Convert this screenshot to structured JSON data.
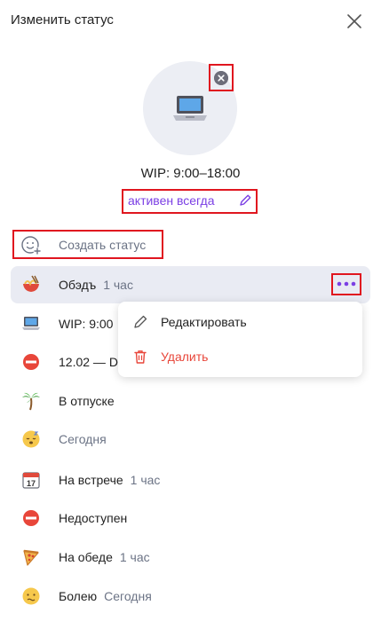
{
  "header": {
    "title": "Изменить статус"
  },
  "current_status": {
    "name": "WIP: 9:00–18:00",
    "active_label": "активен всегда",
    "emoji": "laptop-icon"
  },
  "create_status": {
    "label": "Создать статус"
  },
  "statuses": [
    {
      "name": "Обэдъ",
      "duration": "1 час",
      "emoji": "noodles-icon"
    },
    {
      "name": "WIP: 9:00",
      "duration": "",
      "emoji": "laptop-icon"
    },
    {
      "name": "12.02 — D",
      "duration": "",
      "emoji": "no-entry-icon"
    },
    {
      "name": "В отпуске",
      "duration": "",
      "emoji": "palm-tree-icon"
    },
    {
      "name": "",
      "duration": "Сегодня",
      "emoji": "sleeping-face-icon"
    },
    {
      "name": "На встрече",
      "duration": "1 час",
      "emoji": "calendar-icon"
    },
    {
      "name": "Недоступен",
      "duration": "",
      "emoji": "no-entry-icon"
    },
    {
      "name": "На обеде",
      "duration": "1 час",
      "emoji": "pizza-icon"
    },
    {
      "name": "Болею",
      "duration": "Сегодня",
      "emoji": "sick-face-icon"
    }
  ],
  "context_menu": {
    "edit_label": "Редактировать",
    "delete_label": "Удалить"
  },
  "colors": {
    "accent": "#7b3fe4",
    "danger": "#e8463a",
    "highlight": "#e0161f",
    "hover_row": "#e9ebf3",
    "muted": "#6b7385"
  }
}
